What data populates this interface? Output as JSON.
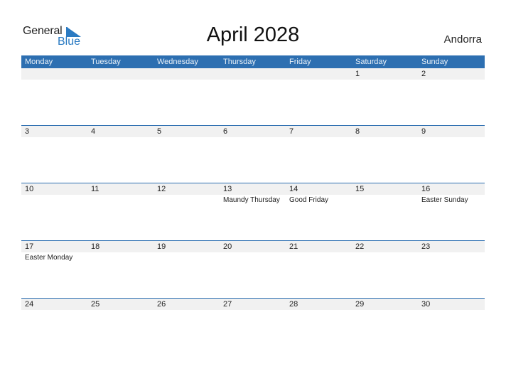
{
  "logo": {
    "line1": "General",
    "line2": "Blue"
  },
  "title": "April 2028",
  "country": "Andorra",
  "colors": {
    "header_bg": "#2d6fb1",
    "strip_bg": "#f1f1f1",
    "brand_blue": "#2a7ac2"
  },
  "weekdays": [
    "Monday",
    "Tuesday",
    "Wednesday",
    "Thursday",
    "Friday",
    "Saturday",
    "Sunday"
  ],
  "weeks": [
    [
      {
        "day": "",
        "holiday": ""
      },
      {
        "day": "",
        "holiday": ""
      },
      {
        "day": "",
        "holiday": ""
      },
      {
        "day": "",
        "holiday": ""
      },
      {
        "day": "",
        "holiday": ""
      },
      {
        "day": "1",
        "holiday": ""
      },
      {
        "day": "2",
        "holiday": ""
      }
    ],
    [
      {
        "day": "3",
        "holiday": ""
      },
      {
        "day": "4",
        "holiday": ""
      },
      {
        "day": "5",
        "holiday": ""
      },
      {
        "day": "6",
        "holiday": ""
      },
      {
        "day": "7",
        "holiday": ""
      },
      {
        "day": "8",
        "holiday": ""
      },
      {
        "day": "9",
        "holiday": ""
      }
    ],
    [
      {
        "day": "10",
        "holiday": ""
      },
      {
        "day": "11",
        "holiday": ""
      },
      {
        "day": "12",
        "holiday": ""
      },
      {
        "day": "13",
        "holiday": "Maundy Thursday"
      },
      {
        "day": "14",
        "holiday": "Good Friday"
      },
      {
        "day": "15",
        "holiday": ""
      },
      {
        "day": "16",
        "holiday": "Easter Sunday"
      }
    ],
    [
      {
        "day": "17",
        "holiday": "Easter Monday"
      },
      {
        "day": "18",
        "holiday": ""
      },
      {
        "day": "19",
        "holiday": ""
      },
      {
        "day": "20",
        "holiday": ""
      },
      {
        "day": "21",
        "holiday": ""
      },
      {
        "day": "22",
        "holiday": ""
      },
      {
        "day": "23",
        "holiday": ""
      }
    ],
    [
      {
        "day": "24",
        "holiday": ""
      },
      {
        "day": "25",
        "holiday": ""
      },
      {
        "day": "26",
        "holiday": ""
      },
      {
        "day": "27",
        "holiday": ""
      },
      {
        "day": "28",
        "holiday": ""
      },
      {
        "day": "29",
        "holiday": ""
      },
      {
        "day": "30",
        "holiday": ""
      }
    ]
  ]
}
